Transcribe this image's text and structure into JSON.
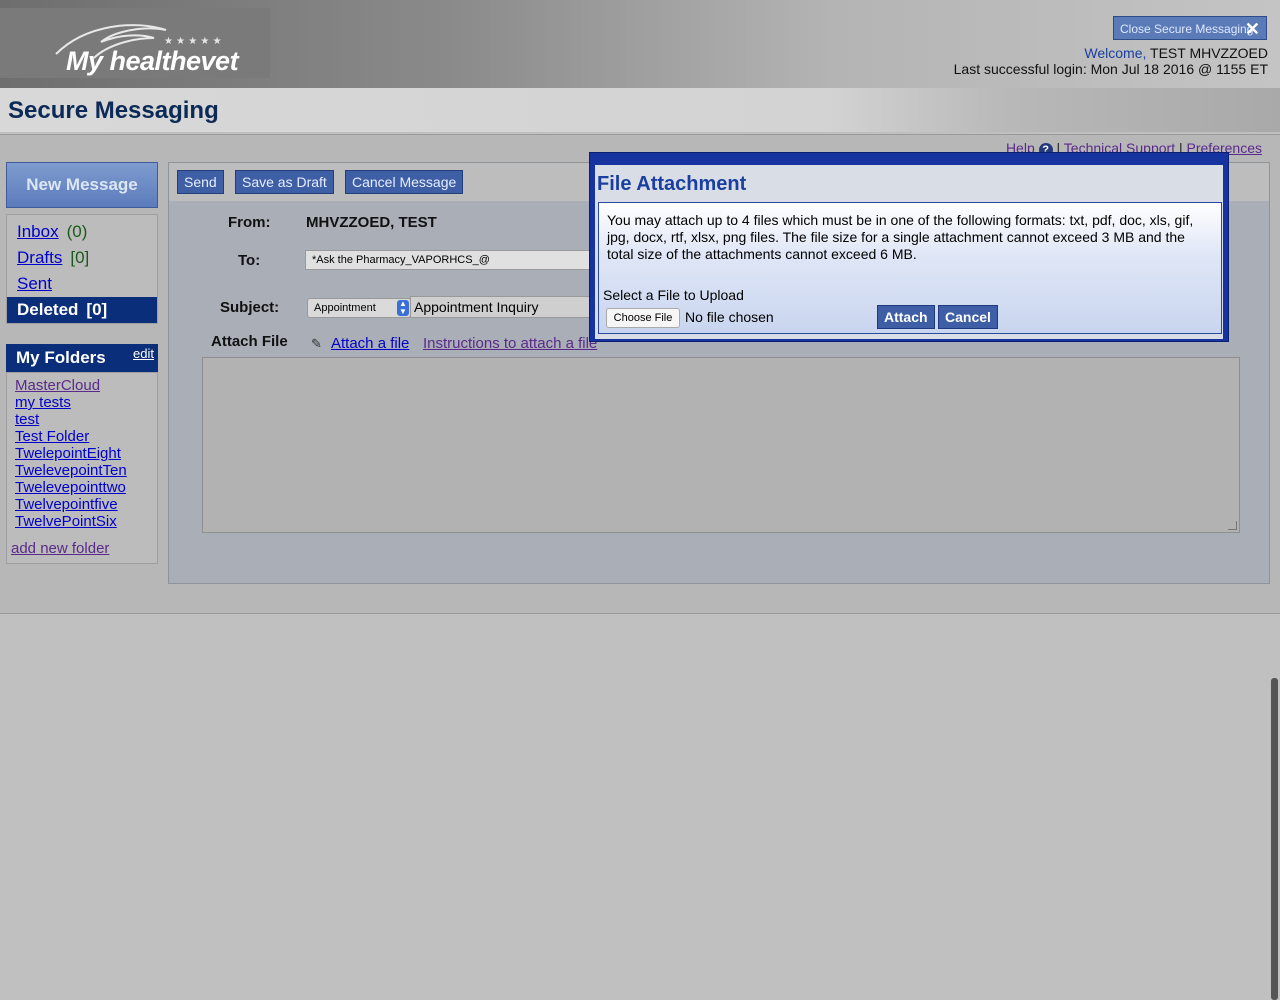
{
  "header": {
    "logo_text": "My healthevet",
    "close_button": "Close Secure Messaging",
    "welcome_label": "Welcome,",
    "user_name": "TEST MHVZZOED",
    "last_login": "Last successful login: Mon Jul 18 2016 @ 1155 ET"
  },
  "page": {
    "title": "Secure Messaging"
  },
  "top_links": {
    "help": "Help",
    "technical_support": "Technical Support",
    "preferences": "Preferences"
  },
  "sidebar": {
    "new_message": "New Message",
    "folders": [
      {
        "label": "Inbox",
        "count": "(0)"
      },
      {
        "label": "Drafts",
        "count": "[0]"
      },
      {
        "label": "Sent",
        "count": ""
      },
      {
        "label": "Deleted",
        "count": "[0]"
      }
    ],
    "my_folders_title": "My Folders",
    "edit_label": "edit",
    "user_folders": [
      "MasterCloud",
      "my tests",
      "test",
      "Test Folder",
      "TwelepointEight",
      "TwelevepointTen",
      "Twelevepointtwo",
      "Twelvepointfive",
      "TwelvePointSix"
    ],
    "add_folder": "add new folder"
  },
  "compose": {
    "toolbar": {
      "send": "Send",
      "save_draft": "Save as Draft",
      "cancel": "Cancel Message"
    },
    "from_label": "From:",
    "from_value": "MHVZZOED, TEST",
    "to_label": "To:",
    "to_value": "*Ask the Pharmacy_VAPORHCS_@",
    "subject_label": "Subject:",
    "subject_category": "Appointment",
    "subject_value": "Appointment Inquiry",
    "attach_label": "Attach File",
    "attach_link": "Attach a file",
    "instructions_link": "Instructions to attach a file"
  },
  "modal": {
    "title": "File Attachment",
    "instructions": "You may attach up to 4 files which must be in one of the following formats: txt, pdf, doc, xls, gif, jpg, docx, rtf, xlsx, png files. The file size for a single attachment cannot exceed 3 MB and the total size of the attachments cannot exceed 6 MB.",
    "upload_label": "Select a File to Upload",
    "choose_file": "Choose File",
    "no_file": "No file chosen",
    "attach_button": "Attach",
    "cancel_button": "Cancel"
  },
  "icons": [
    "close-icon",
    "help-icon",
    "paperclip-icon",
    "select-arrow-icon",
    "eagle-logo-icon"
  ]
}
